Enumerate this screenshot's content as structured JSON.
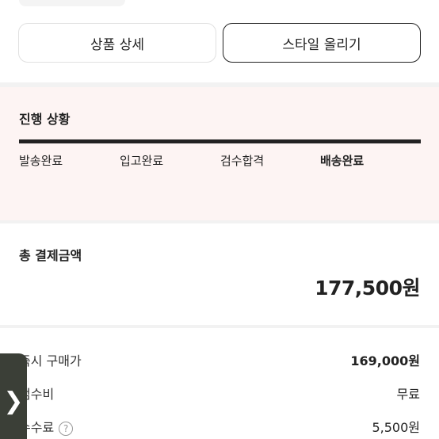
{
  "buttons": {
    "product_detail": "상품 상세",
    "style_upload": "스타일 올리기"
  },
  "progress": {
    "title": "진행 상황",
    "steps": [
      "발송완료",
      "입고완료",
      "검수합격",
      "배송완료"
    ],
    "current_step_index": 3,
    "bar_fill_fraction": 1.0
  },
  "total": {
    "label": "총 결제금액",
    "amount": "177,500원"
  },
  "lines": [
    {
      "label": "즉시 구매가",
      "value": "169,000원"
    },
    {
      "label": "검수비",
      "value": "무료"
    },
    {
      "label": "수수료",
      "value": "5,500원"
    }
  ],
  "icons": {
    "help": "question-circle-icon",
    "handle": "chevron-right-icon"
  },
  "colors": {
    "progress_bg": "#fdf4f3",
    "text_primary": "#222222",
    "handle_bg": "#3b3f37"
  }
}
